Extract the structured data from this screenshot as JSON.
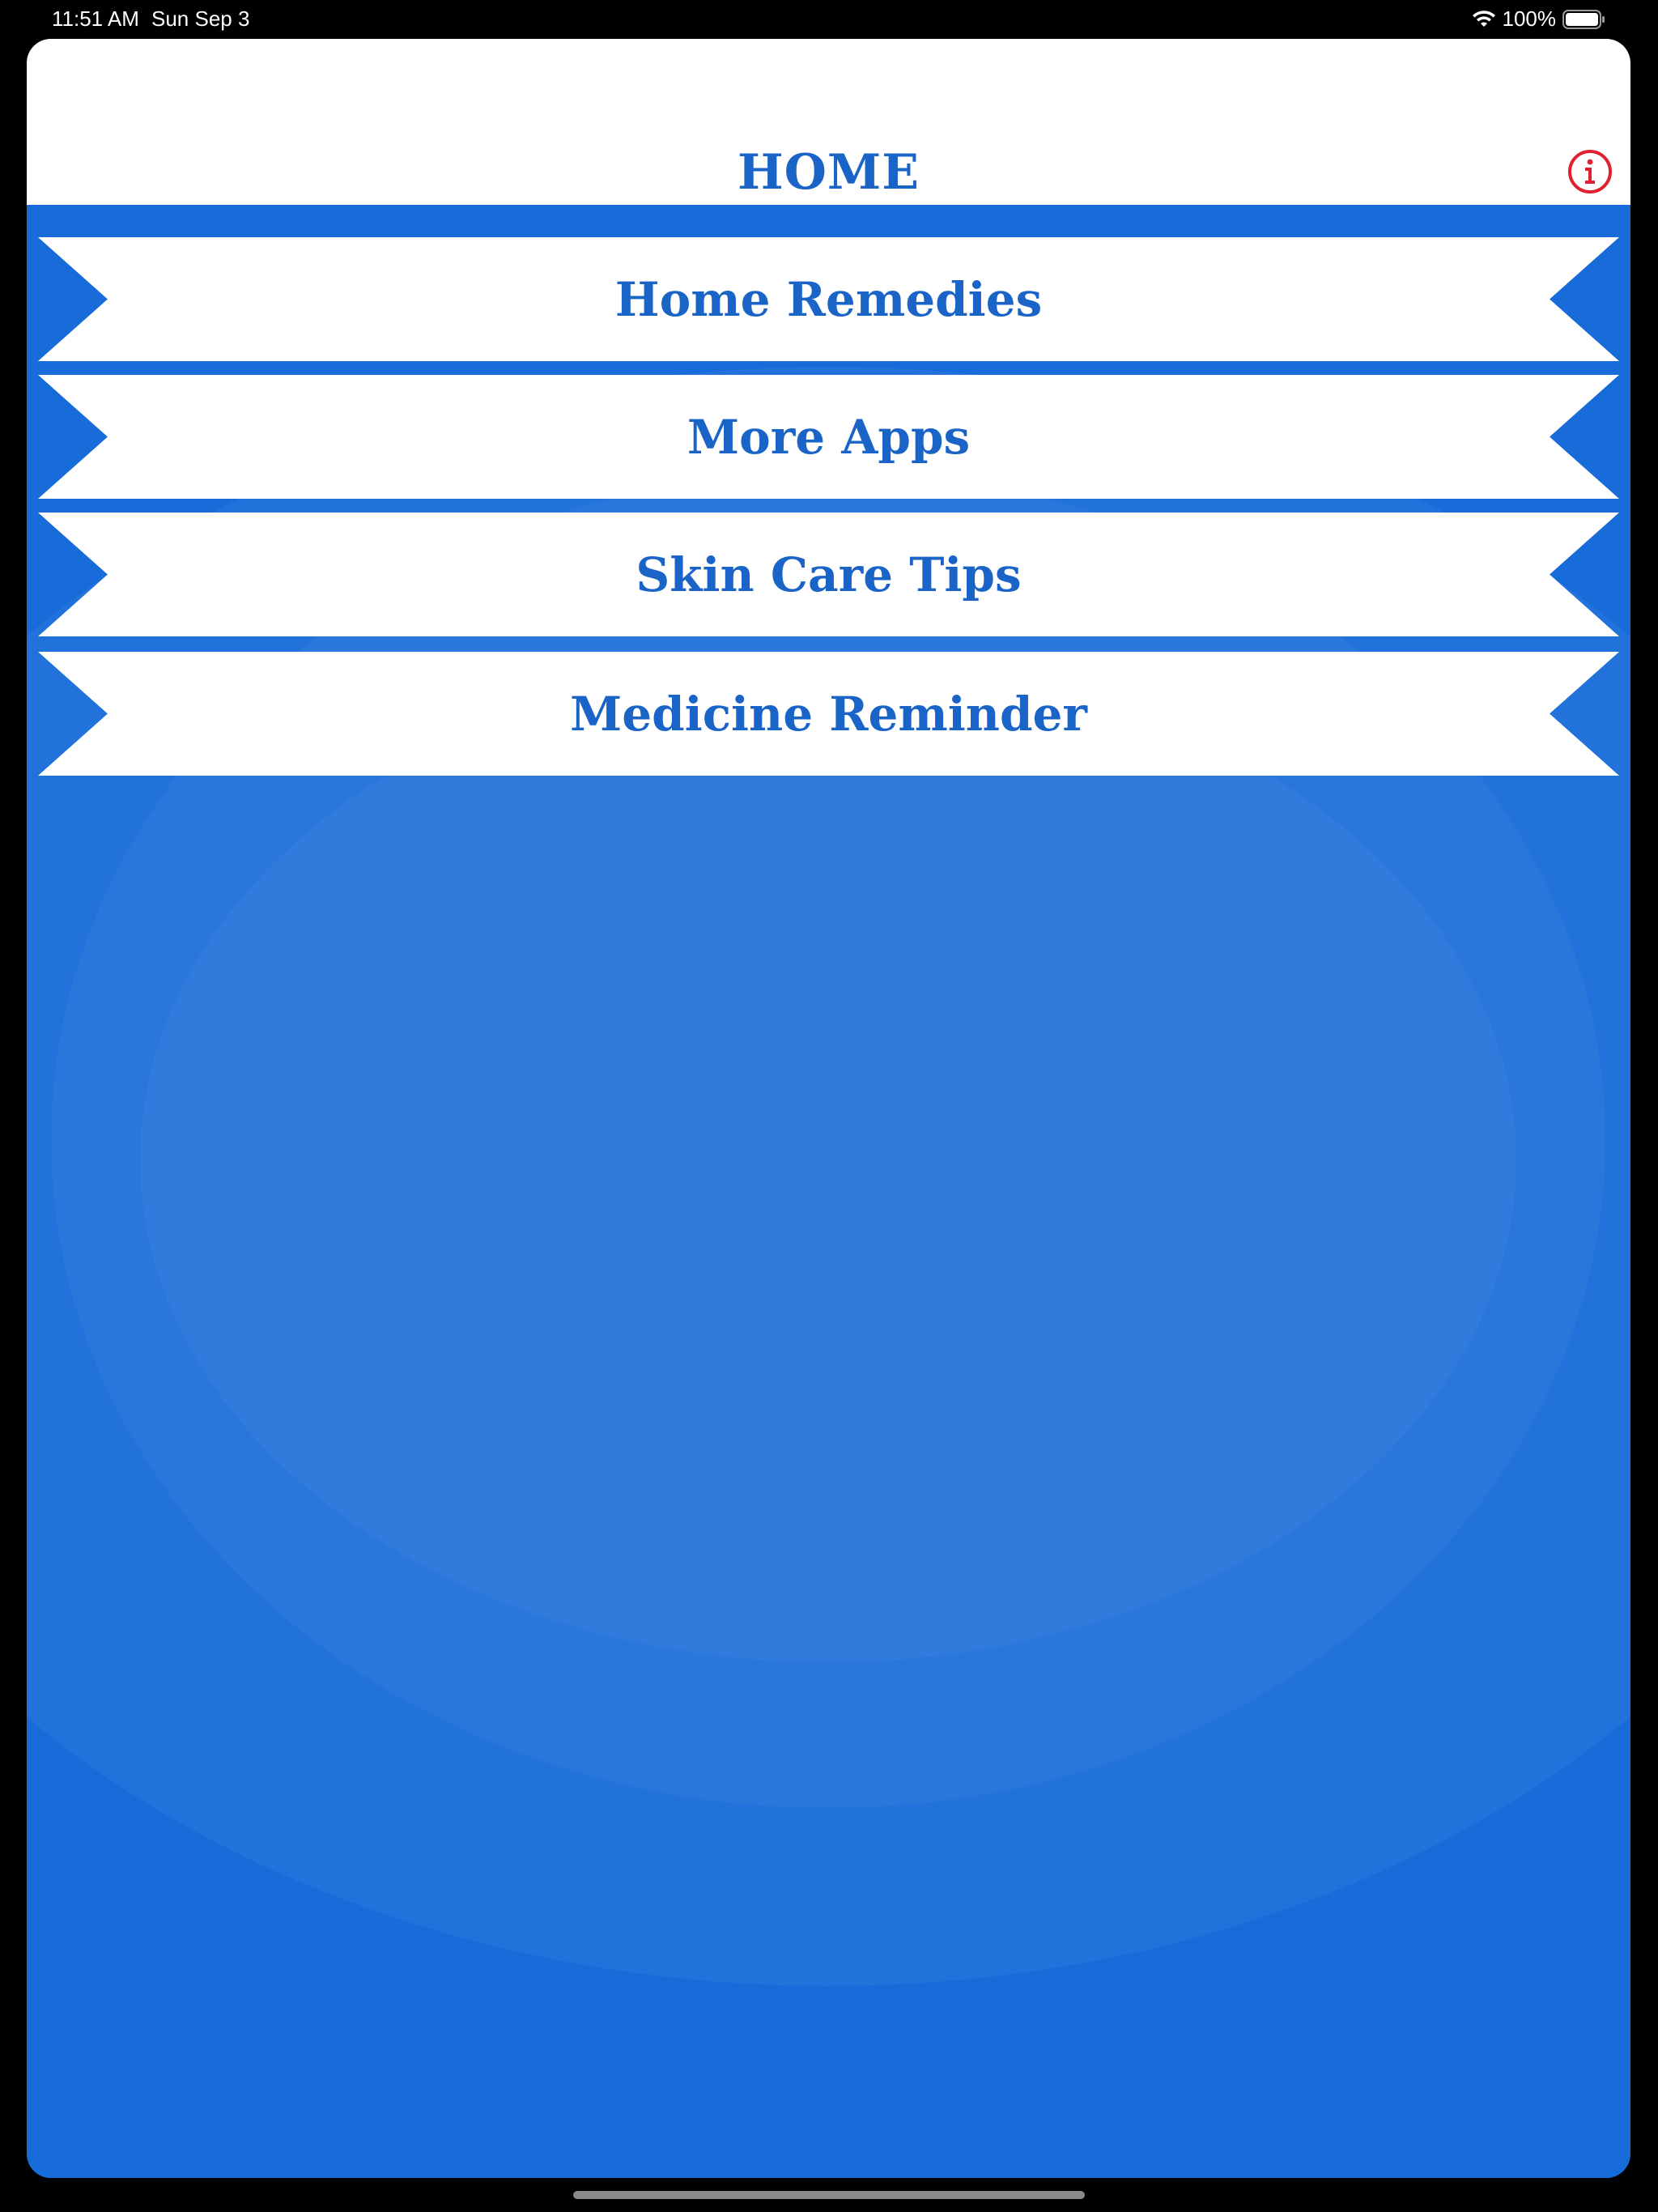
{
  "status_bar": {
    "time": "11:51 AM",
    "date": "Sun Sep 3",
    "battery_percent": "100%",
    "wifi_icon": "wifi-icon",
    "battery_icon": "battery-icon"
  },
  "nav": {
    "title": "HOME",
    "info_icon": "info-icon"
  },
  "menu": {
    "items": [
      {
        "label": "Home Remedies"
      },
      {
        "label": "More Apps"
      },
      {
        "label": "Skin Care Tips"
      },
      {
        "label": "Medicine Reminder"
      }
    ]
  },
  "colors": {
    "accent_blue": "#1a64c8",
    "background_blue": "#186cd9",
    "info_red": "#e0202e"
  }
}
